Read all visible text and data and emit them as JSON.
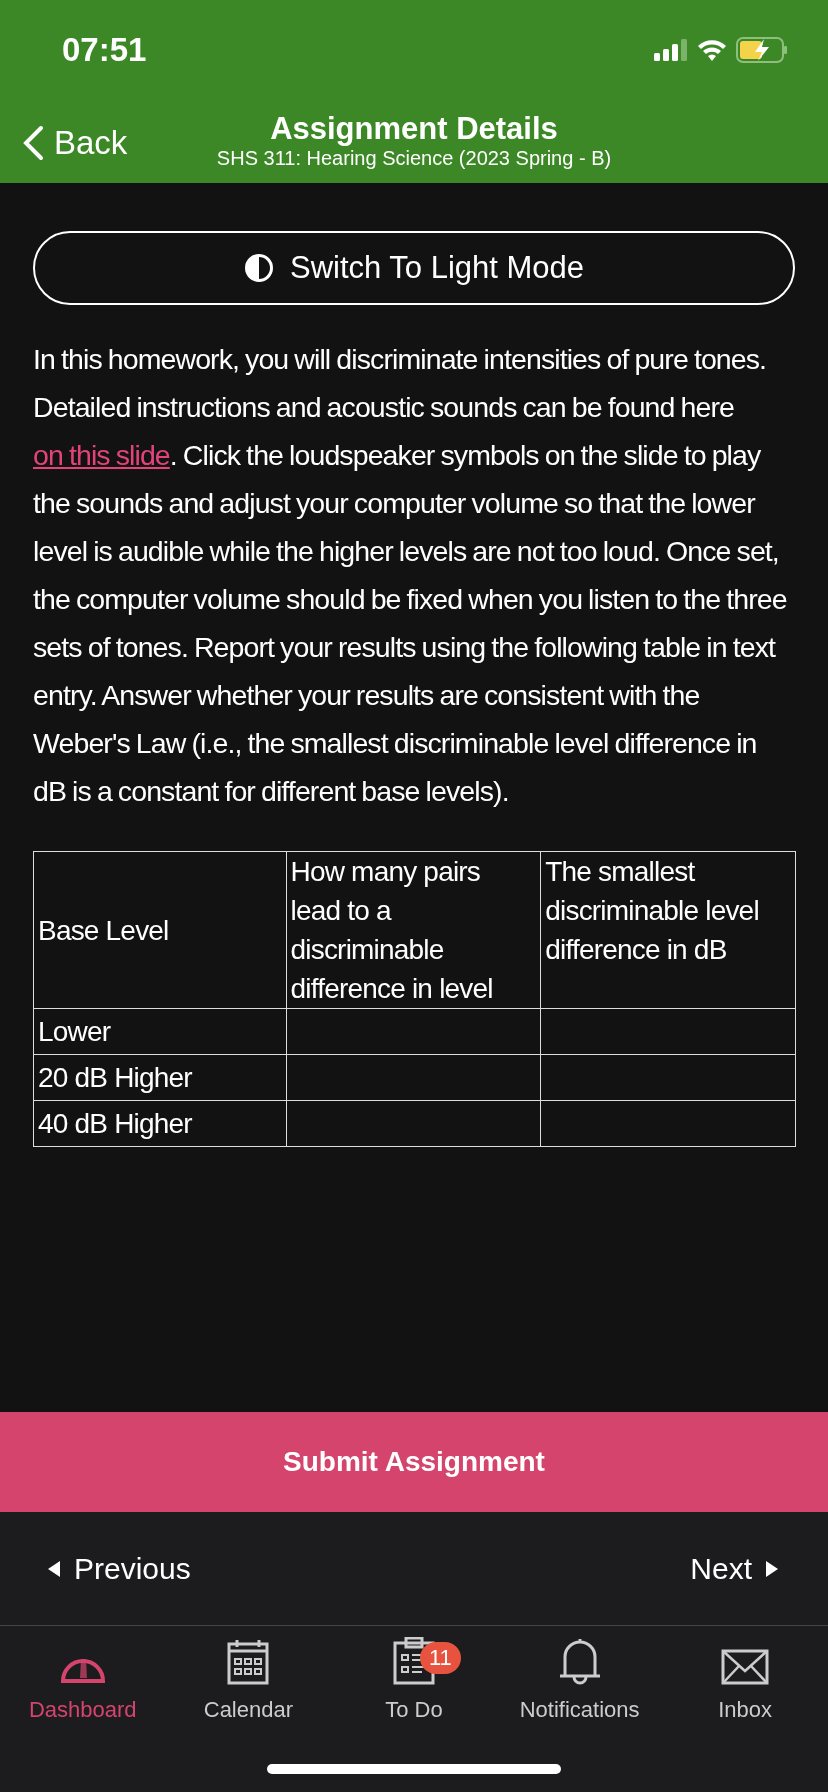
{
  "status_bar": {
    "time": "07:51"
  },
  "header": {
    "back": "Back",
    "title": "Assignment Details",
    "subtitle": "SHS 311: Hearing Science (2023 Spring - B)"
  },
  "theme_button": {
    "label": "Switch To Light Mode"
  },
  "description": {
    "before": "In this homework, you will discriminate intensities of pure tones. Detailed instructions and acoustic sounds can be found here ",
    "link": "on this slide",
    "after": ". Click the loudspeaker symbols on the slide to play the sounds and adjust your computer volume so that the lower level is audible while the higher levels are not too loud. Once set, the computer volume should be fixed when you listen to the three sets of tones. Report your results using the following table in text entry. Answer whether your results are consistent with the Weber's Law (i.e., the smallest discriminable level difference in dB is a constant for different base levels)."
  },
  "table": {
    "columns": [
      "Base Level",
      "How many pairs lead to a discriminable difference in level",
      "The smallest discriminable level difference in dB"
    ],
    "rows": [
      [
        "Lower"
      ],
      [
        "20 dB Higher"
      ],
      [
        "40 dB Higher"
      ]
    ]
  },
  "submit_button": "Submit Assignment",
  "pager": {
    "previous": "Previous",
    "next": "Next"
  },
  "tab_bar": [
    {
      "label": "Dashboard",
      "kind": "gauge",
      "selected": true
    },
    {
      "label": "Calendar",
      "kind": "calendar",
      "selected": false
    },
    {
      "label": "To Do",
      "kind": "todo",
      "selected": false,
      "badge": "11"
    },
    {
      "label": "Notifications",
      "kind": "bell",
      "selected": false
    },
    {
      "label": "Inbox",
      "kind": "mail",
      "selected": false
    }
  ]
}
